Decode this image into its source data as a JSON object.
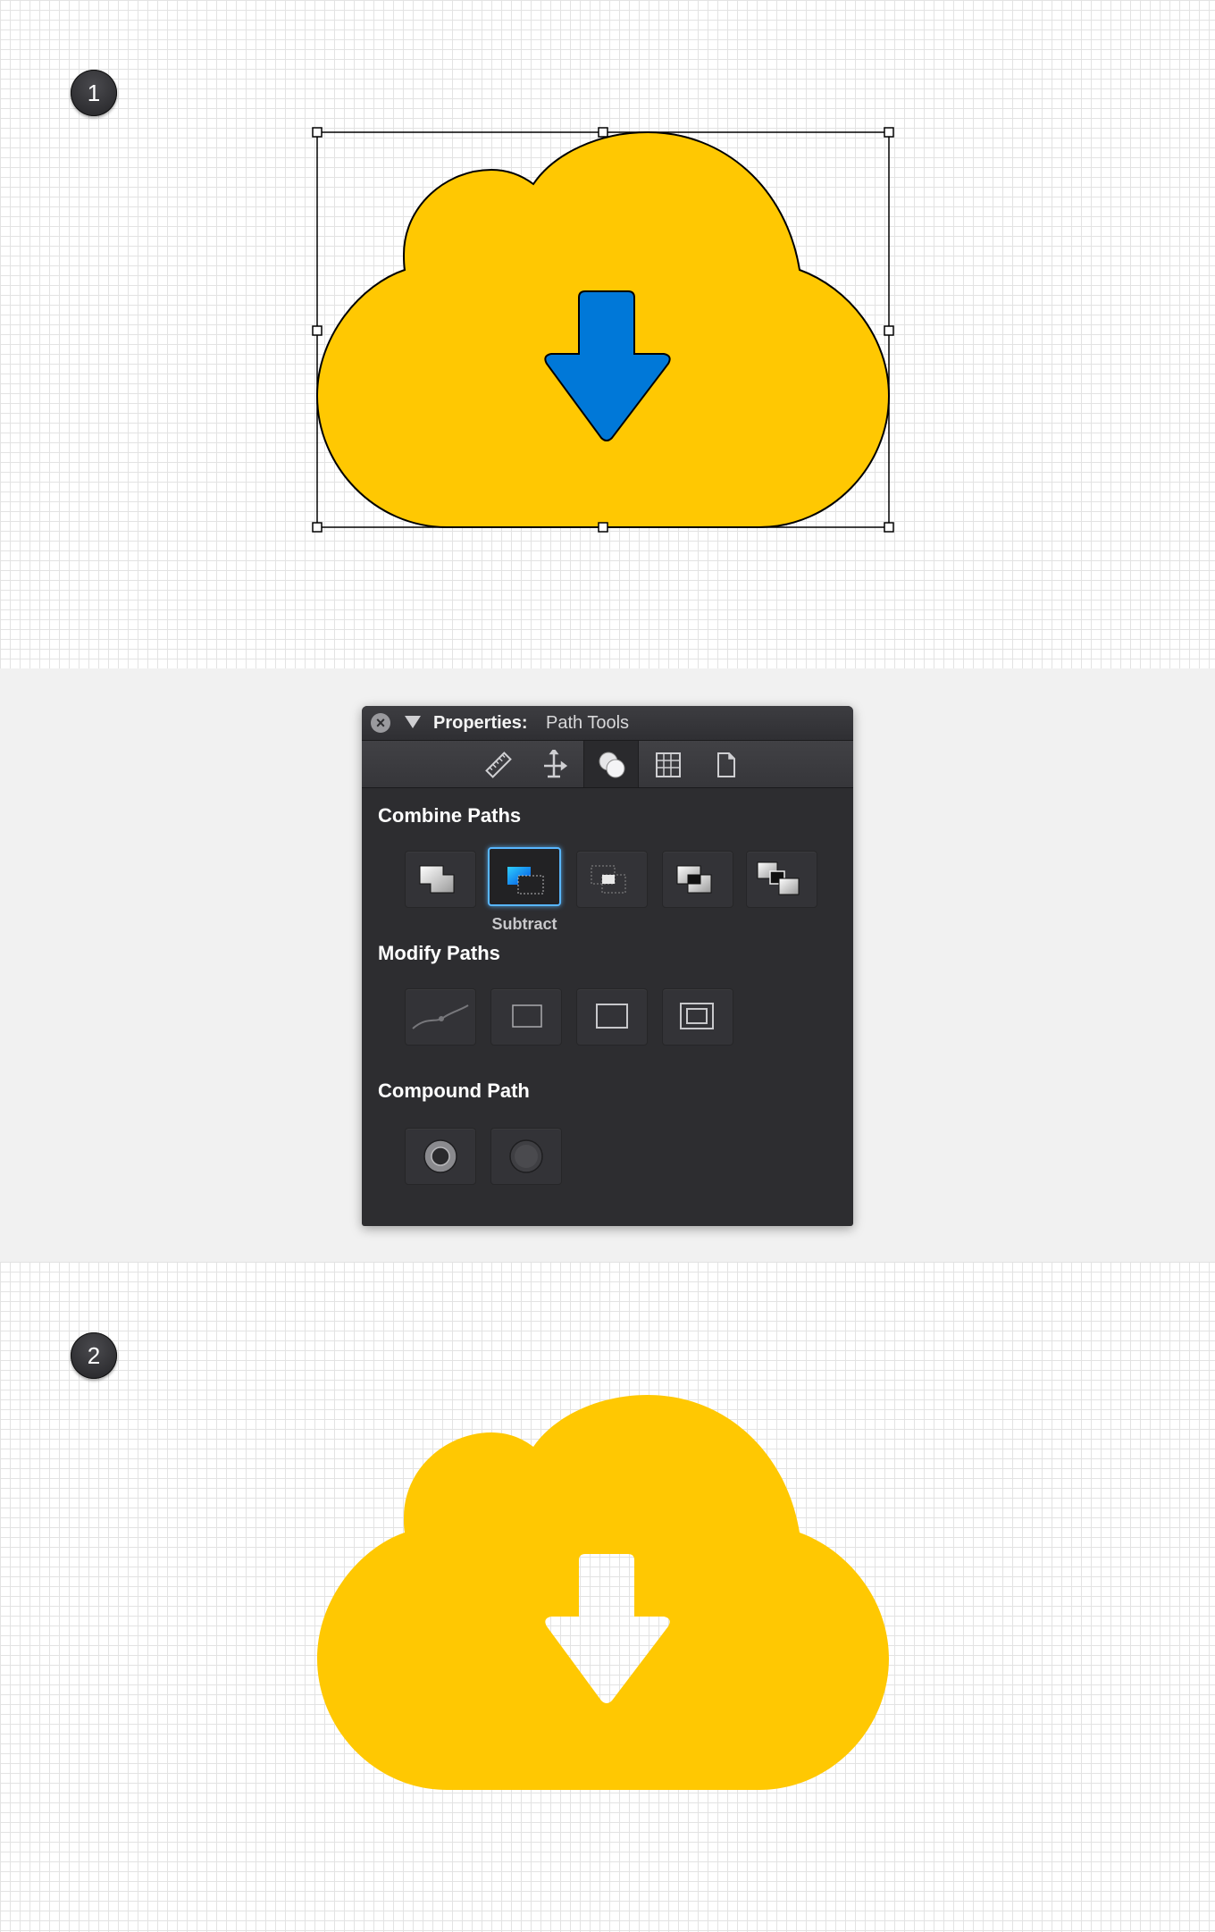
{
  "steps": {
    "first": "1",
    "second": "2"
  },
  "panel": {
    "title_label": "Properties:",
    "title_value": "Path Tools",
    "toolbar_icons": [
      "ruler-icon",
      "move-transform-icon",
      "path-tools-icon",
      "grid-icon",
      "document-icon"
    ],
    "combine_label": "Combine Paths",
    "modify_label": "Modify Paths",
    "compound_label": "Compound Path",
    "selected_caption": "Subtract"
  },
  "colors": {
    "cloud_yellow": "#ffc802",
    "arrow_blue": "#0078d8",
    "selection_highlight": "#58b6ff"
  }
}
